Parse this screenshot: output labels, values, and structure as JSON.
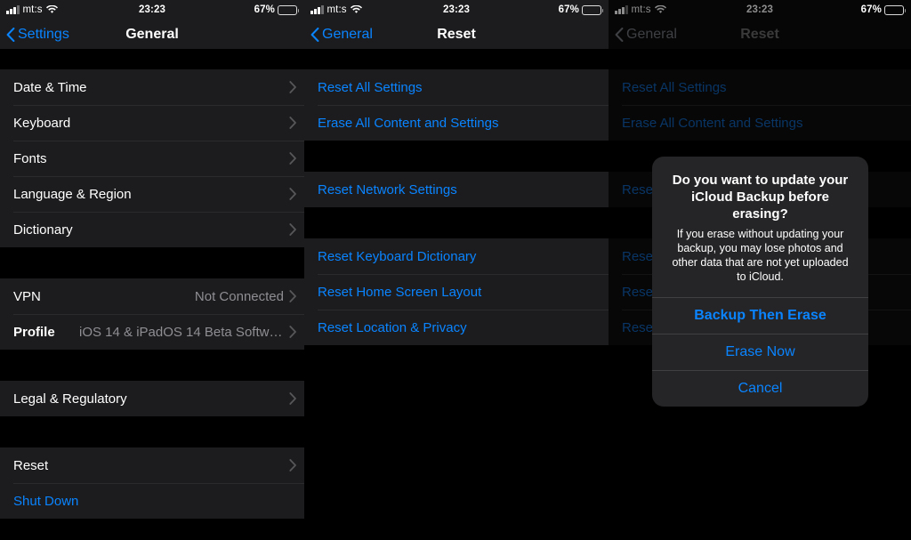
{
  "status_bar": {
    "carrier": "mt:s",
    "time": "23:23",
    "battery_percent": "67%",
    "signal_icon": "cellular-bars-icon",
    "wifi_icon": "wifi-icon",
    "battery_icon": "battery-icon"
  },
  "colors": {
    "accent_blue": "#0a84ff",
    "row_background": "#1c1c1e",
    "screen_background": "#000000",
    "separator": "#3a3a3c",
    "secondary_text": "#8e8e93",
    "alert_background": "#252527"
  },
  "panel_general": {
    "nav": {
      "back_label": "Settings",
      "title": "General",
      "back_icon": "chevron-left-icon"
    },
    "group_one": [
      {
        "label": "Date & Time",
        "accessory": "chevron-right-icon"
      },
      {
        "label": "Keyboard",
        "accessory": "chevron-right-icon"
      },
      {
        "label": "Fonts",
        "accessory": "chevron-right-icon"
      },
      {
        "label": "Language & Region",
        "accessory": "chevron-right-icon"
      },
      {
        "label": "Dictionary",
        "accessory": "chevron-right-icon"
      }
    ],
    "group_two": [
      {
        "label": "VPN",
        "value": "Not Connected",
        "accessory": "chevron-right-icon"
      },
      {
        "label": "Profile",
        "value": "iOS 14 & iPadOS 14 Beta Softwar…",
        "accessory": "chevron-right-icon"
      }
    ],
    "group_three": [
      {
        "label": "Legal & Regulatory",
        "accessory": "chevron-right-icon"
      }
    ],
    "group_four": [
      {
        "label": "Reset",
        "accessory": "chevron-right-icon"
      },
      {
        "label": "Shut Down"
      }
    ]
  },
  "panel_reset": {
    "nav": {
      "back_label": "General",
      "title": "Reset",
      "back_icon": "chevron-left-icon"
    },
    "group_one": [
      {
        "label": "Reset All Settings"
      },
      {
        "label": "Erase All Content and Settings"
      }
    ],
    "group_two": [
      {
        "label": "Reset Network Settings"
      }
    ],
    "group_three": [
      {
        "label": "Reset Keyboard Dictionary"
      },
      {
        "label": "Reset Home Screen Layout"
      },
      {
        "label": "Reset Location & Privacy"
      }
    ]
  },
  "panel_alert": {
    "nav": {
      "back_label": "General",
      "title": "Reset",
      "back_icon": "chevron-left-icon"
    },
    "group_one": [
      {
        "label": "Reset All Settings"
      },
      {
        "label": "Erase All Content and Settings"
      }
    ],
    "group_two": [
      {
        "label": "Reset"
      }
    ],
    "group_three": [
      {
        "label": "Reset"
      },
      {
        "label": "Reset"
      },
      {
        "label": "Reset"
      }
    ],
    "alert": {
      "title": "Do you want to update your iCloud Backup before erasing?",
      "message": "If you erase without updating your backup, you may lose photos and other data that are not yet uploaded to iCloud.",
      "buttons": [
        {
          "label": "Backup Then Erase",
          "emphasis": "bold"
        },
        {
          "label": "Erase Now",
          "emphasis": "normal"
        },
        {
          "label": "Cancel",
          "emphasis": "normal"
        }
      ]
    }
  }
}
